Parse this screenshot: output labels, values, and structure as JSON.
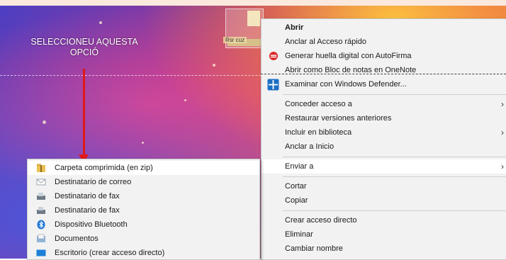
{
  "desktop": {
    "callout_lines": [
      "SELECCIONEU AQUESTA",
      "OPCIÓ"
    ],
    "file_label": "Rsr cuz"
  },
  "context_menu": {
    "items": [
      {
        "label": "Abrir"
      },
      {
        "label": "Anclar al Acceso rápido"
      },
      {
        "label": "Generar huella digital con AutoFirma",
        "icon": "autofirma-icon"
      },
      {
        "label": "Abrir como Bloc de notas en OneNote"
      },
      {
        "label": "Examinar con Windows Defender...",
        "icon": "windows-defender-icon"
      },
      {
        "label": "Conceder acceso a"
      },
      {
        "label": "Restaurar versiones anteriores"
      },
      {
        "label": "Incluir en biblioteca"
      },
      {
        "label": "Anclar a Inicio"
      },
      {
        "label": "Enviar a"
      },
      {
        "label": "Cortar"
      },
      {
        "label": "Copiar"
      },
      {
        "label": "Crear acceso directo"
      },
      {
        "label": "Eliminar"
      },
      {
        "label": "Cambiar nombre"
      }
    ],
    "submenu_arrow": "›"
  },
  "send_to_submenu": {
    "items": [
      {
        "label": "Carpeta comprimida (en zip)",
        "icon": "zip-folder-icon"
      },
      {
        "label": "Destinatario de correo",
        "icon": "mail-icon"
      },
      {
        "label": "Destinatario de fax",
        "icon": "fax-icon"
      },
      {
        "label": "Destinatario de fax",
        "icon": "fax-icon"
      },
      {
        "label": "Dispositivo Bluetooth",
        "icon": "bluetooth-icon"
      },
      {
        "label": "Documentos",
        "icon": "documents-icon"
      },
      {
        "label": "Escritorio (crear acceso directo)",
        "icon": "desktop-icon"
      }
    ]
  },
  "colors": {
    "menu_bg": "#f2f2f2",
    "highlight": "#ffffff",
    "arrow": "#e01818"
  }
}
